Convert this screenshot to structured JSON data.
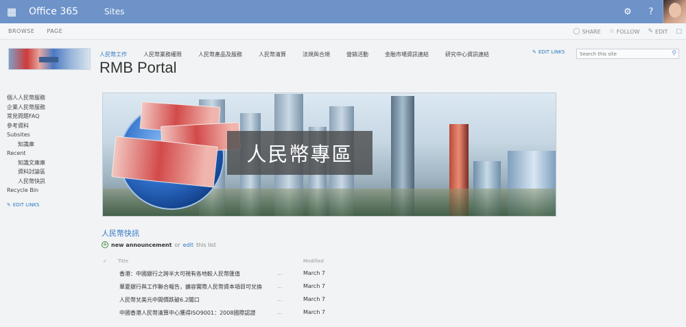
{
  "suite": {
    "brand": "Office 365",
    "link": "Sites",
    "waffle_icon": "waffle-icon",
    "settings_icon": "gear-icon",
    "help_icon": "help-icon",
    "accent": "#6d93c9"
  },
  "ribbon": {
    "tabs": [
      "BROWSE",
      "PAGE"
    ],
    "share": "SHARE",
    "follow": "FOLLOW",
    "edit": "EDIT"
  },
  "topnav": {
    "items": [
      "人民幣工作",
      "人民幣業務權限",
      "人民幣產品及服務",
      "人民幣清算",
      "法規與合規",
      "營銷活動",
      "金融市場資訊連結",
      "研究中心資訊連結"
    ],
    "edit_links": "EDIT LINKS",
    "search_placeholder": "Search this site"
  },
  "site": {
    "title": "RMB Portal"
  },
  "leftnav": {
    "items": [
      {
        "label": "個人人民幣服務",
        "indent": false
      },
      {
        "label": "企業人民幣服務",
        "indent": false
      },
      {
        "label": "常見問題FAQ",
        "indent": false
      },
      {
        "label": "參考資料",
        "indent": false
      },
      {
        "label": "Subsites",
        "indent": false
      },
      {
        "label": "知識庫",
        "indent": true
      },
      {
        "label": "Recent",
        "indent": false
      },
      {
        "label": "知識文庫庫",
        "indent": true
      },
      {
        "label": "資料討論區",
        "indent": true
      },
      {
        "label": "人民幣快訊",
        "indent": true
      },
      {
        "label": "Recycle Bin",
        "indent": false
      }
    ],
    "edit_links": "EDIT LINKS"
  },
  "banner": {
    "caption": "人民幣專區"
  },
  "announcements": {
    "title": "人民幣快訊",
    "new_label": "new announcement",
    "or_text": "or",
    "edit_text": "edit",
    "this_list": "this list",
    "col_title": "Title",
    "col_date": "Modified",
    "rows": [
      {
        "title": "香港：中國銀行之跨半大可視有各地較人民幣匯值",
        "date": "March 7"
      },
      {
        "title": "華夏銀行與工作聯合報告，擴容實際人民幣資本項目可兌換",
        "date": "March 7"
      },
      {
        "title": "人民幣兌美元中間價跌破6.2關口",
        "date": "March 7"
      },
      {
        "title": "中國香港人民幣清算中心獲得ISO9001：2008國際認證",
        "date": "March 7"
      }
    ]
  }
}
